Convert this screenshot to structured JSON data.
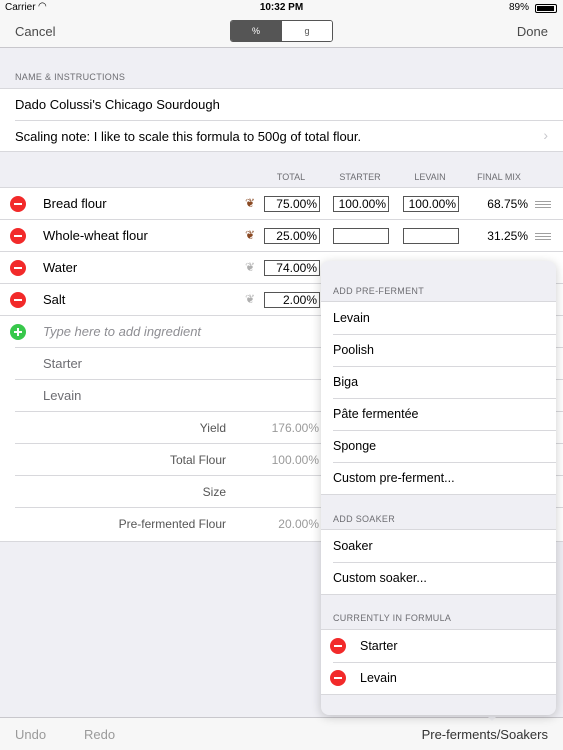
{
  "status": {
    "carrier": "Carrier",
    "time": "10:32 PM",
    "battery": "89%",
    "battery_level": 0.89
  },
  "nav": {
    "cancel": "Cancel",
    "done": "Done",
    "seg_percent": "%",
    "seg_grams": "g"
  },
  "name_section": {
    "header": "NAME & INSTRUCTIONS",
    "title": "Dado Colussi's Chicago Sourdough",
    "note": "Scaling note: I like to scale this formula to 500g of total flour."
  },
  "table": {
    "columns": {
      "total": "TOTAL",
      "starter": "STARTER",
      "levain": "LEVAIN",
      "final_mix": "FINAL MIX"
    },
    "rows": [
      {
        "name": "Bread flour",
        "total": "75.00%",
        "starter": "100.00%",
        "levain": "100.00%",
        "final": "68.75%"
      },
      {
        "name": "Whole-wheat flour",
        "total": "25.00%",
        "starter": "",
        "levain": "",
        "final": "31.25%"
      },
      {
        "name": "Water",
        "total": "74.00%",
        "starter": "",
        "levain": "",
        "final": ""
      },
      {
        "name": "Salt",
        "total": "2.00%",
        "starter": "",
        "levain": "",
        "final": ""
      }
    ],
    "add_placeholder": "Type here to add ingredient",
    "preferments": [
      "Starter",
      "Levain"
    ],
    "summary": [
      {
        "label": "Yield",
        "value": "176.00%"
      },
      {
        "label": "Total Flour",
        "value": "100.00%"
      },
      {
        "label": "Size",
        "value": ""
      },
      {
        "label": "Pre-fermented Flour",
        "value": "20.00%"
      }
    ]
  },
  "popover": {
    "add_preferment_header": "ADD PRE-FERMENT",
    "preferment_options": [
      "Levain",
      "Poolish",
      "Biga",
      "Pâte fermentée",
      "Sponge",
      "Custom pre-ferment..."
    ],
    "add_soaker_header": "ADD SOAKER",
    "soaker_options": [
      "Soaker",
      "Custom soaker..."
    ],
    "current_header": "CURRENTLY IN FORMULA",
    "current_items": [
      "Starter",
      "Levain"
    ]
  },
  "toolbar": {
    "undo": "Undo",
    "redo": "Redo",
    "preferments": "Pre-ferments/Soakers"
  },
  "colors": {
    "delete": "#f22a2a",
    "add": "#38c84b",
    "toolbar_disabled": "#9a9a9a"
  }
}
